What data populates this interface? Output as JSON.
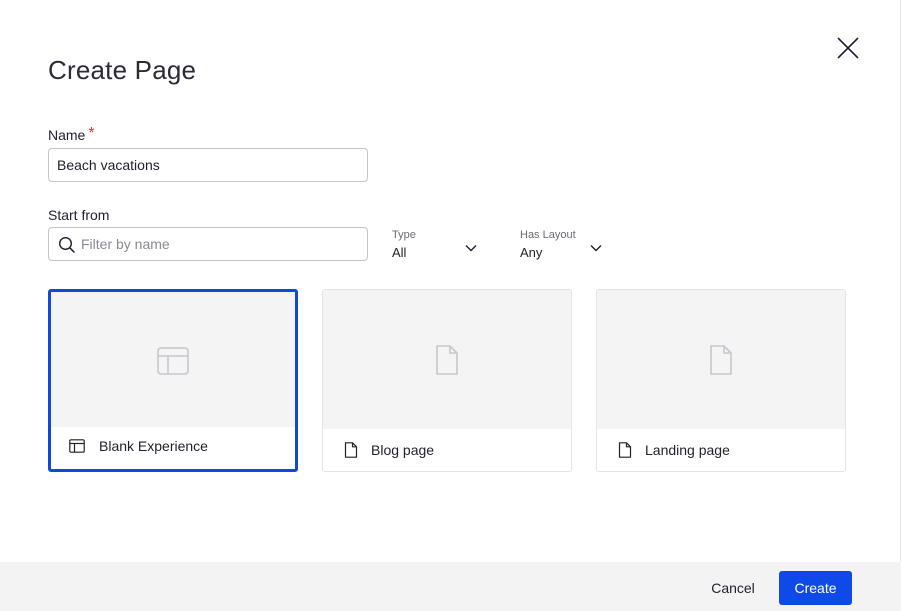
{
  "dialog": {
    "title": "Create Page"
  },
  "name_field": {
    "label": "Name",
    "required_marker": "*",
    "value": "Beach vacations"
  },
  "start_from": {
    "label": "Start from",
    "search_placeholder": "Filter by name",
    "filters": [
      {
        "label": "Type",
        "value": "All"
      },
      {
        "label": "Has Layout",
        "value": "Any"
      }
    ]
  },
  "templates": [
    {
      "label": "Blank Experience",
      "icon": "layout-icon",
      "selected": true
    },
    {
      "label": "Blog page",
      "icon": "document-icon",
      "selected": false
    },
    {
      "label": "Landing page",
      "icon": "document-icon",
      "selected": false
    }
  ],
  "footer": {
    "cancel_label": "Cancel",
    "create_label": "Create"
  },
  "colors": {
    "primary": "#0f49e8",
    "selected_border": "#0f49d9",
    "required": "#e0322b"
  }
}
